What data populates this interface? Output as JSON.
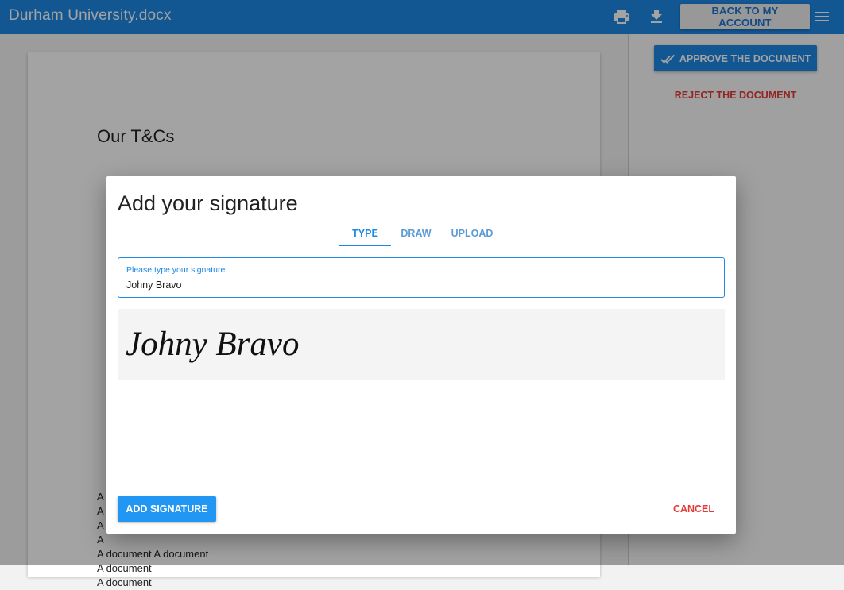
{
  "header": {
    "title": "Durham University.docx",
    "back_label": "BACK TO MY ACCOUNT",
    "icons": [
      "print-icon",
      "download-icon",
      "menu-icon"
    ]
  },
  "document": {
    "heading": "Our T&Cs",
    "lines": [
      "A",
      "A",
      "A",
      "A",
      "A document A document",
      "A document",
      "A document"
    ]
  },
  "side_panel": {
    "approve_label": "APPROVE THE DOCUMENT",
    "reject_label": "REJECT THE DOCUMENT"
  },
  "modal": {
    "title": "Add your signature",
    "tabs": [
      {
        "label": "TYPE",
        "active": true
      },
      {
        "label": "DRAW",
        "active": false
      },
      {
        "label": "UPLOAD",
        "active": false
      }
    ],
    "field_label": "Please type your signature",
    "field_value": "Johny Bravo",
    "preview_text": "Johny Bravo",
    "add_label": "ADD SIGNATURE",
    "cancel_label": "CANCEL"
  },
  "colors": {
    "primary": "#1e88e5",
    "danger": "#e53935"
  }
}
